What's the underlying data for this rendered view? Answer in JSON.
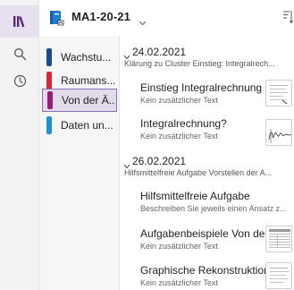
{
  "notebook": {
    "title": "MA1-20-21"
  },
  "sections": [
    {
      "label": "Wachstu...",
      "color": "#1a4c8f",
      "selected": false
    },
    {
      "label": "Raumans...",
      "color": "#d32a3a",
      "selected": false
    },
    {
      "label": "Von der Ä...",
      "color": "#a01a7a",
      "selected": true
    },
    {
      "label": "Daten un...",
      "color": "#1e90d6",
      "selected": false
    }
  ],
  "groups": [
    {
      "date": "24.02.2021",
      "description": "Klärung zu Cluster  Einstieg: Integralrech...",
      "pages": [
        {
          "title": "Einstieg Integralrechnung",
          "subtitle": "Kein zusätzlicher Text",
          "thumbnail": "lined-page"
        },
        {
          "title": "Integralrechnung?",
          "subtitle": "Kein zusätzlicher Text",
          "thumbnail": "handwriting"
        }
      ]
    },
    {
      "date": "26.02.2021",
      "description": "Hilfsmittelfreie Aufgabe  Vorstellen der A...",
      "pages": [
        {
          "title": "Hilfsmittelfreie Aufgabe",
          "subtitle": "Beschreiben Sie jeweils einen Ansatz z...",
          "thumbnail": null
        },
        {
          "title": "Aufgabenbeispiele Von der...",
          "subtitle": "Kein zusätzlicher Text",
          "thumbnail": "table-page"
        },
        {
          "title": "Graphische Rekonstruktion",
          "subtitle": "Kein zusätzlicher Text",
          "thumbnail": "lined-page"
        }
      ]
    }
  ],
  "icons": {
    "rail": [
      "notebooks-icon",
      "search-icon",
      "recent-clock-icon"
    ],
    "header": [
      "notebook-icon",
      "chevron-down-icon",
      "sort-icon"
    ]
  },
  "colors": {
    "accent": "#7a2fa5",
    "selection_bg": "#e2dbea",
    "selection_border": "#8a6fb8"
  }
}
